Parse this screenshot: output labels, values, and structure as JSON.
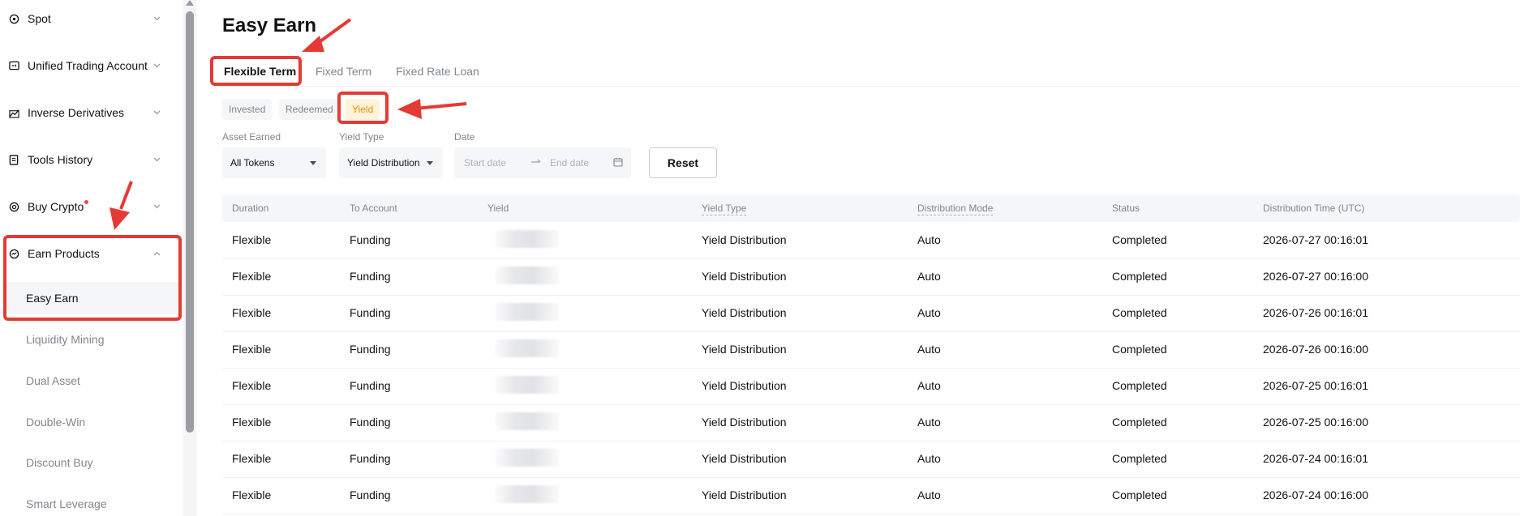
{
  "sidebar": {
    "items": [
      {
        "label": "Spot",
        "icon": "spot-icon"
      },
      {
        "label": "Unified Trading Account",
        "icon": "account-icon"
      },
      {
        "label": "Inverse Derivatives",
        "icon": "derivatives-icon"
      },
      {
        "label": "Tools History",
        "icon": "history-icon"
      },
      {
        "label": "Buy Crypto",
        "icon": "buy-crypto-icon"
      },
      {
        "label": "Earn Products",
        "icon": "earn-icon"
      }
    ],
    "sub_items": [
      {
        "label": "Easy Earn",
        "active": true
      },
      {
        "label": "Liquidity Mining"
      },
      {
        "label": "Dual Asset"
      },
      {
        "label": "Double-Win"
      },
      {
        "label": "Discount Buy"
      },
      {
        "label": "Smart Leverage"
      }
    ]
  },
  "page": {
    "title": "Easy Earn"
  },
  "tabs": [
    "Flexible Term",
    "Fixed Term",
    "Fixed Rate Loan"
  ],
  "subtabs": [
    "Invested",
    "Redeemed",
    "Yield"
  ],
  "filters": {
    "asset_label": "Asset Earned",
    "asset_value": "All Tokens",
    "yield_type_label": "Yield Type",
    "yield_type_value": "Yield Distribution",
    "date_label": "Date",
    "start_placeholder": "Start date",
    "end_placeholder": "End date",
    "reset_label": "Reset"
  },
  "table": {
    "columns": [
      "Duration",
      "To Account",
      "Yield",
      "Yield Type",
      "Distribution Mode",
      "Status",
      "Distribution Time (UTC)"
    ],
    "rows": [
      [
        "Flexible",
        "Funding",
        "",
        "Yield Distribution",
        "Auto",
        "Completed",
        "2026-07-27 00:16:01"
      ],
      [
        "Flexible",
        "Funding",
        "",
        "Yield Distribution",
        "Auto",
        "Completed",
        "2026-07-27 00:16:00"
      ],
      [
        "Flexible",
        "Funding",
        "",
        "Yield Distribution",
        "Auto",
        "Completed",
        "2026-07-26 00:16:01"
      ],
      [
        "Flexible",
        "Funding",
        "",
        "Yield Distribution",
        "Auto",
        "Completed",
        "2026-07-26 00:16:00"
      ],
      [
        "Flexible",
        "Funding",
        "",
        "Yield Distribution",
        "Auto",
        "Completed",
        "2026-07-25 00:16:01"
      ],
      [
        "Flexible",
        "Funding",
        "",
        "Yield Distribution",
        "Auto",
        "Completed",
        "2026-07-25 00:16:00"
      ],
      [
        "Flexible",
        "Funding",
        "",
        "Yield Distribution",
        "Auto",
        "Completed",
        "2026-07-24 00:16:01"
      ],
      [
        "Flexible",
        "Funding",
        "",
        "Yield Distribution",
        "Auto",
        "Completed",
        "2026-07-24 00:16:00"
      ]
    ]
  },
  "colors": {
    "accent": "#f7a600",
    "annotation": "#e53935",
    "notify_dot": "#ef454a"
  }
}
